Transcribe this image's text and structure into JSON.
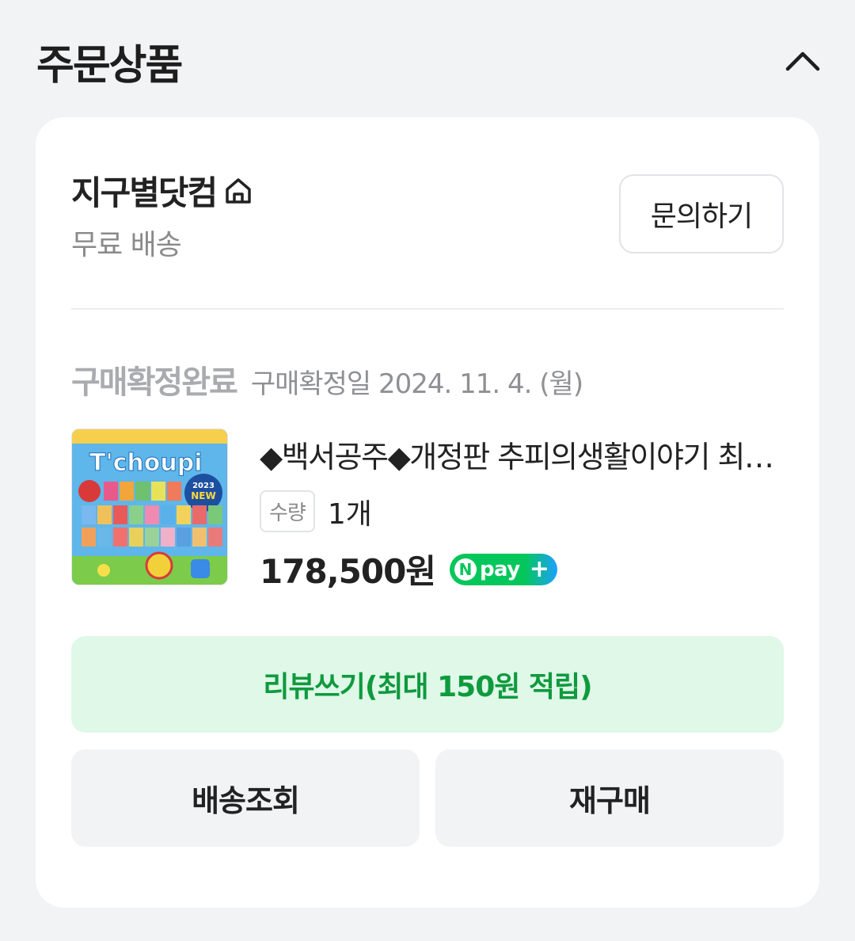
{
  "section": {
    "title": "주문상품",
    "collapse_icon": "chevron-up-icon"
  },
  "seller": {
    "name": "지구별닷컴",
    "home_icon": "home-icon",
    "shipping": "무료 배송",
    "inquiry_label": "문의하기"
  },
  "status": {
    "main": "구매확정완료",
    "date": "구매확정일 2024. 11. 4. (월)"
  },
  "product": {
    "thumb_title": "T'choupi",
    "thumb_badge_year": "2023",
    "thumb_badge_new": "NEW",
    "name": "◆백서공주◆개정판 추피의생활이야기 최신판 전집",
    "qty_label": "수량",
    "qty_value": "1개",
    "price": "178,500원",
    "npay_n": "N",
    "npay_text": "pay",
    "npay_plus": "+"
  },
  "actions": {
    "review_label": "리뷰쓰기(최대 150원 적립)",
    "track_label": "배송조회",
    "rebuy_label": "재구매"
  },
  "colors": {
    "accent_green": "#0f9a3e",
    "review_bg": "#dff8e8",
    "npay_green": "#03c75a",
    "npay_blue": "#1ea0ff"
  }
}
